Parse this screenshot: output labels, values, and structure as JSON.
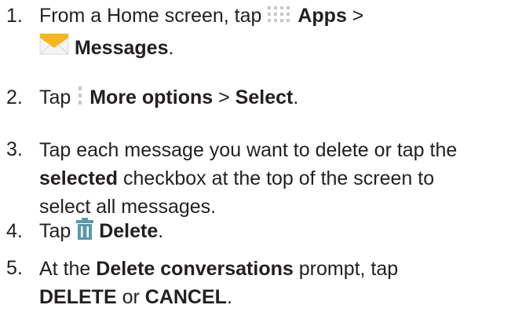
{
  "steps": [
    {
      "number": "1.",
      "t1": "From a Home screen, tap",
      "apps_label": "Apps",
      "t2": ">",
      "messages_label": "Messages",
      "t3": "."
    },
    {
      "number": "2.",
      "t1": "Tap",
      "more_options_label": "More options",
      "t2": ">",
      "select_label": "Select",
      "t3": "."
    },
    {
      "number": "3.",
      "t1": "Tap each message you want to delete or tap the",
      "selected_label": "selected",
      "t2": "checkbox at the top of the screen to",
      "t3": "select all messages."
    },
    {
      "number": "4.",
      "t1": "Tap",
      "delete_label": "Delete",
      "t2": "."
    },
    {
      "number": "5.",
      "t1": "At the",
      "prompt_label": "Delete conversations",
      "t2": "prompt, tap",
      "delete_button_label": "DELETE",
      "t3": "or",
      "cancel_button_label": "CANCEL",
      "t4": "."
    }
  ],
  "icons": {
    "apps": "apps-grid-icon",
    "messages": "messages-envelope-icon",
    "more_options": "more-options-icon",
    "delete": "trash-icon"
  },
  "colors": {
    "text": "#231f20",
    "icon_gray": "#c8c8c8",
    "envelope_yellow": "#f7b718",
    "trash_teal": "#5a9aa8"
  }
}
